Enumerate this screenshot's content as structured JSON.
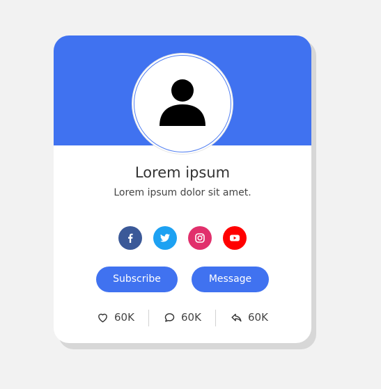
{
  "colors": {
    "accent": "#4072f0",
    "facebook": "#3b5998",
    "twitter": "#1da1f2",
    "instagram": "#e1306c",
    "youtube": "#ff0000"
  },
  "profile": {
    "name": "Lorem ipsum",
    "bio": "Lorem ipsum dolor sit amet."
  },
  "socials": [
    {
      "icon": "facebook-icon"
    },
    {
      "icon": "twitter-icon"
    },
    {
      "icon": "instagram-icon"
    },
    {
      "icon": "youtube-icon"
    }
  ],
  "actions": {
    "subscribe_label": "Subscribe",
    "message_label": "Message"
  },
  "stats": {
    "likes": "60K",
    "comments": "60K",
    "shares": "60K"
  }
}
